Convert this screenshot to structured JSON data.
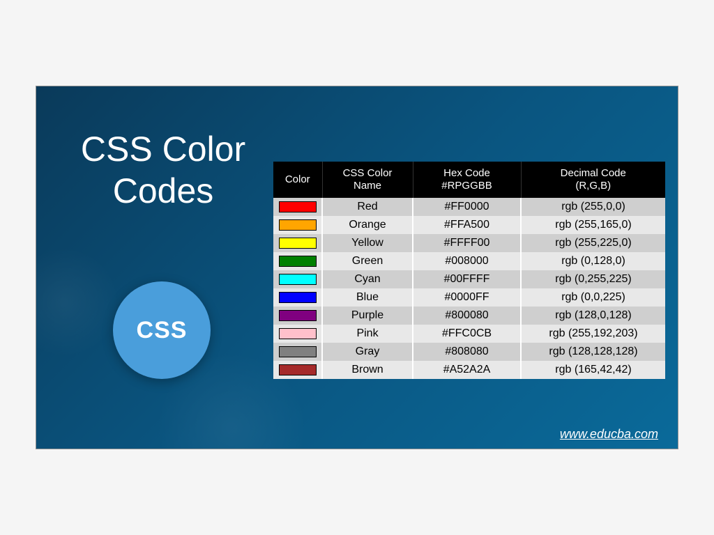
{
  "title_line1": "CSS Color",
  "title_line2": "Codes",
  "badge_text": "CSS",
  "footer_url": "www.educba.com",
  "headers": {
    "color": "Color",
    "name": "CSS Color\nName",
    "hex": "Hex Code\n#RPGGBB",
    "rgb": "Decimal Code\n(R,G,B)"
  },
  "chart_data": {
    "type": "table",
    "title": "CSS Color Codes",
    "columns": [
      "Color",
      "CSS Color Name",
      "Hex Code #RPGGBB",
      "Decimal Code (R,G,B)"
    ],
    "rows": [
      {
        "swatch": "#FF0000",
        "name": "Red",
        "hex": "#FF0000",
        "rgb": "rgb (255,0,0)"
      },
      {
        "swatch": "#FFA500",
        "name": "Orange",
        "hex": "#FFA500",
        "rgb": "rgb (255,165,0)"
      },
      {
        "swatch": "#FFFF00",
        "name": "Yellow",
        "hex": "#FFFF00",
        "rgb": "rgb (255,225,0)"
      },
      {
        "swatch": "#008000",
        "name": "Green",
        "hex": "#008000",
        "rgb": "rgb (0,128,0)"
      },
      {
        "swatch": "#00FFFF",
        "name": "Cyan",
        "hex": "#00FFFF",
        "rgb": "rgb (0,255,225)"
      },
      {
        "swatch": "#0000FF",
        "name": "Blue",
        "hex": "#0000FF",
        "rgb": "rgb (0,0,225)"
      },
      {
        "swatch": "#800080",
        "name": "Purple",
        "hex": "#800080",
        "rgb": "rgb (128,0,128)"
      },
      {
        "swatch": "#FFC0CB",
        "name": "Pink",
        "hex": "#FFC0CB",
        "rgb": "rgb (255,192,203)"
      },
      {
        "swatch": "#808080",
        "name": "Gray",
        "hex": "#808080",
        "rgb": "rgb (128,128,128)"
      },
      {
        "swatch": "#A52A2A",
        "name": "Brown",
        "hex": "#A52A2A",
        "rgb": "rgb (165,42,42)"
      }
    ]
  }
}
